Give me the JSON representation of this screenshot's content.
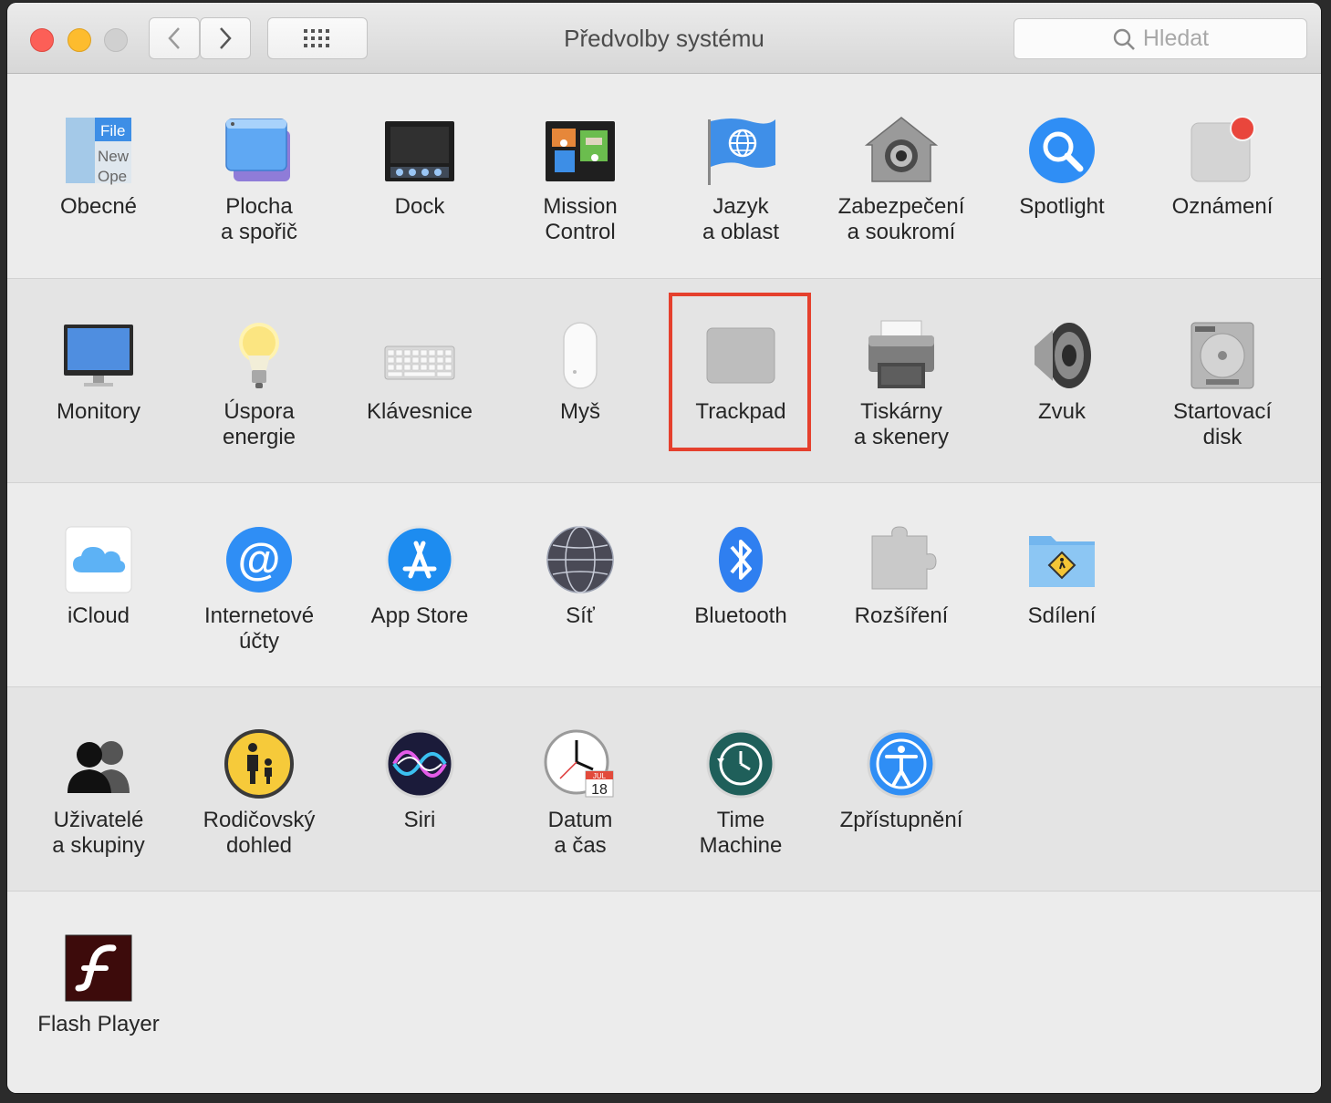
{
  "window": {
    "title": "Předvolby systému",
    "search_placeholder": "Hledat"
  },
  "rows": [
    [
      {
        "label": "Obecné",
        "icon": "general-icon"
      },
      {
        "label": "Plocha\na spořič",
        "icon": "desktop-screensaver-icon"
      },
      {
        "label": "Dock",
        "icon": "dock-icon"
      },
      {
        "label": "Mission\nControl",
        "icon": "mission-control-icon"
      },
      {
        "label": "Jazyk\na oblast",
        "icon": "language-region-flag-icon"
      },
      {
        "label": "Zabezpečení\na soukromí",
        "icon": "security-house-icon"
      },
      {
        "label": "Spotlight",
        "icon": "spotlight-magnifier-icon"
      },
      {
        "label": "Oznámení",
        "icon": "notifications-icon"
      }
    ],
    [
      {
        "label": "Monitory",
        "icon": "displays-monitor-icon"
      },
      {
        "label": "Úspora\nenergie",
        "icon": "energy-saver-bulb-icon"
      },
      {
        "label": "Klávesnice",
        "icon": "keyboard-icon"
      },
      {
        "label": "Myš",
        "icon": "mouse-icon"
      },
      {
        "label": "Trackpad",
        "icon": "trackpad-icon"
      },
      {
        "label": "Tiskárny\na skenery",
        "icon": "printer-icon"
      },
      {
        "label": "Zvuk",
        "icon": "sound-speaker-icon"
      },
      {
        "label": "Startovací\ndisk",
        "icon": "startup-disk-icon"
      }
    ],
    [
      {
        "label": "iCloud",
        "icon": "icloud-icon"
      },
      {
        "label": "Internetové\núčty",
        "icon": "internet-accounts-at-icon"
      },
      {
        "label": "App Store",
        "icon": "app-store-icon"
      },
      {
        "label": "Síť",
        "icon": "network-globe-icon"
      },
      {
        "label": "Bluetooth",
        "icon": "bluetooth-icon"
      },
      {
        "label": "Rozšíření",
        "icon": "extensions-puzzle-icon"
      },
      {
        "label": "Sdílení",
        "icon": "sharing-folder-icon"
      }
    ],
    [
      {
        "label": "Uživatelé\na skupiny",
        "icon": "users-groups-icon"
      },
      {
        "label": "Rodičovský\ndohled",
        "icon": "parental-controls-icon"
      },
      {
        "label": "Siri",
        "icon": "siri-icon"
      },
      {
        "label": "Datum\na čas",
        "icon": "date-time-clock-icon"
      },
      {
        "label": "Time\nMachine",
        "icon": "time-machine-icon"
      },
      {
        "label": "Zpřístupnění",
        "icon": "accessibility-icon"
      }
    ],
    [
      {
        "label": "Flash Player",
        "icon": "flash-player-icon"
      }
    ]
  ],
  "icon_text": {
    "general_file": "File",
    "general_new": "New",
    "general_open": "Ope",
    "calendar_month": "JUL",
    "calendar_day": "18"
  },
  "highlighted_pane": "Trackpad",
  "colors": {
    "highlight": "#e5402d",
    "accent_blue": "#2f7ff0"
  }
}
